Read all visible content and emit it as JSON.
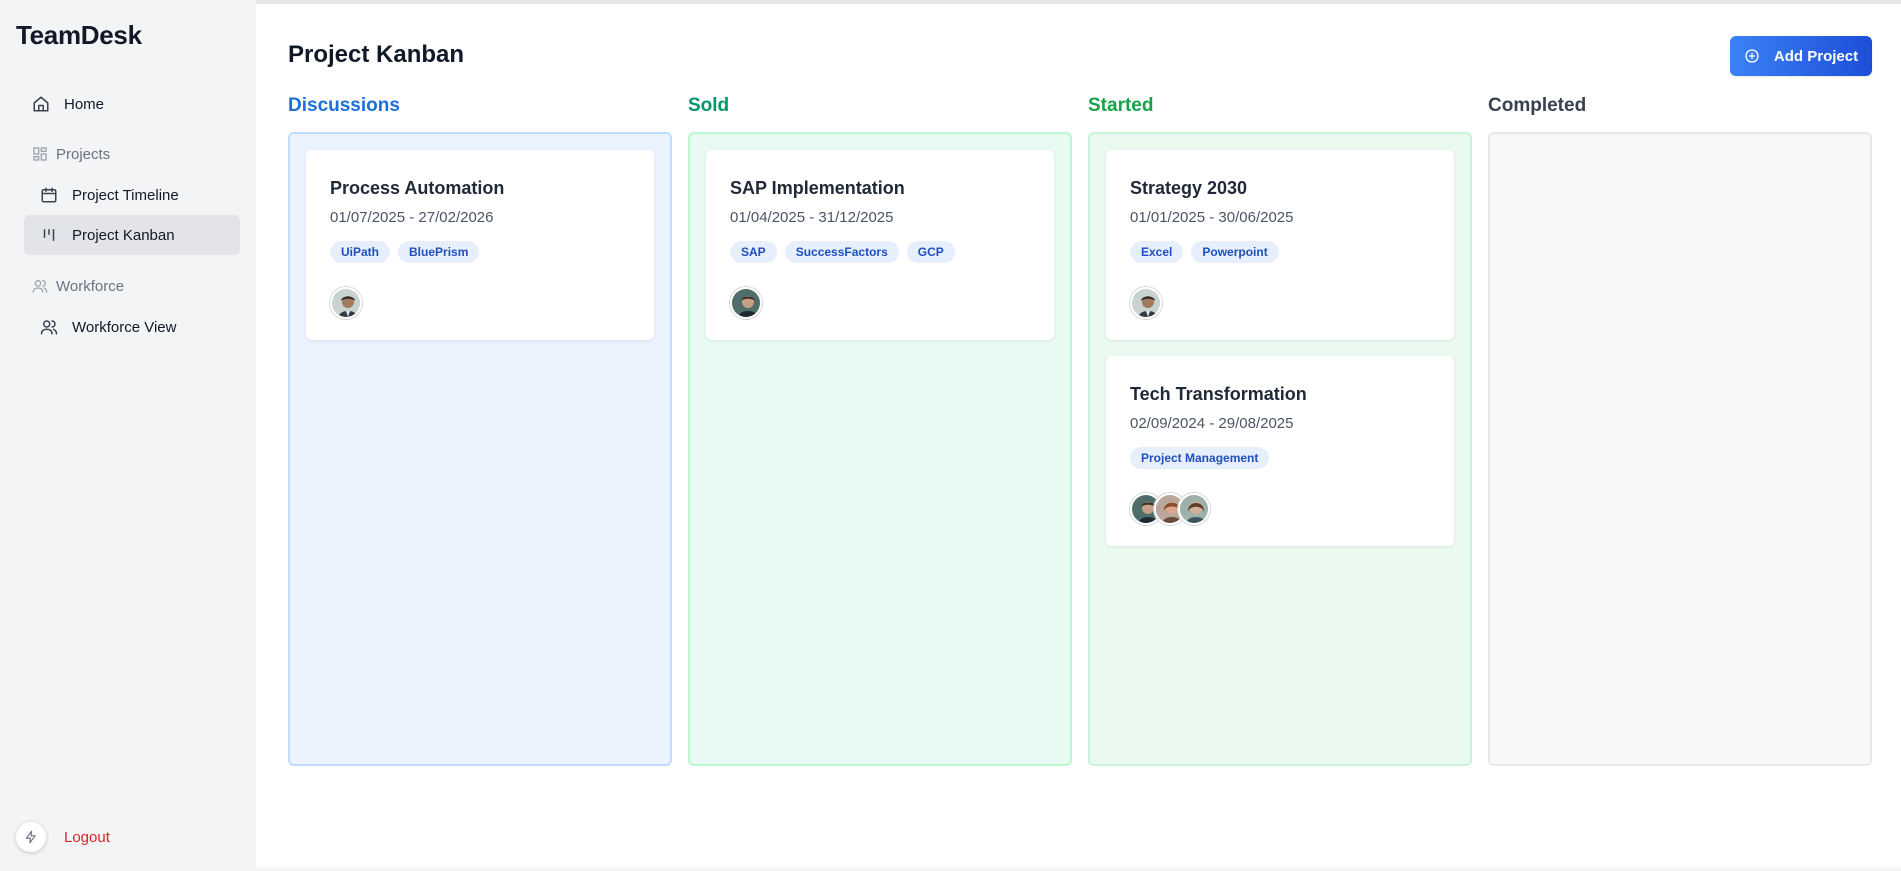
{
  "app": {
    "brand": "TeamDesk"
  },
  "sidebar": {
    "home": "Home",
    "projects_group": "Projects",
    "project_timeline": "Project Timeline",
    "project_kanban": "Project Kanban",
    "workforce_group": "Workforce",
    "workforce_view": "Workforce View",
    "logout": "Logout"
  },
  "header": {
    "title": "Project Kanban",
    "add_button": "Add Project"
  },
  "columns": [
    {
      "title": "Discussions",
      "color": "#1d6fd8",
      "cards": [
        {
          "title": "Process Automation",
          "dates": "01/07/2025 - 27/02/2026",
          "tags": [
            "UiPath",
            "BluePrism"
          ],
          "avatars": 1
        }
      ]
    },
    {
      "title": "Sold",
      "color": "#059669",
      "cards": [
        {
          "title": "SAP Implementation",
          "dates": "01/04/2025 - 31/12/2025",
          "tags": [
            "SAP",
            "SuccessFactors",
            "GCP"
          ],
          "avatars": 1
        }
      ]
    },
    {
      "title": "Started",
      "color": "#16a34a",
      "cards": [
        {
          "title": "Strategy 2030",
          "dates": "01/01/2025 - 30/06/2025",
          "tags": [
            "Excel",
            "Powerpoint"
          ],
          "avatars": 1
        },
        {
          "title": "Tech Transformation",
          "dates": "02/09/2024 - 29/08/2025",
          "tags": [
            "Project Management"
          ],
          "avatars": 3
        }
      ]
    },
    {
      "title": "Completed",
      "color": "#374151",
      "cards": []
    }
  ]
}
